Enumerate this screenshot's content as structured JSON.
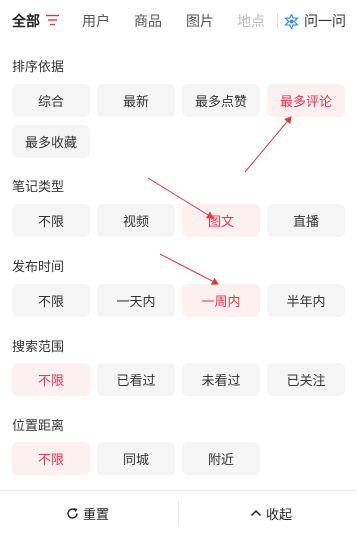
{
  "tabs": [
    {
      "label": "全部"
    },
    {
      "label": "用户"
    },
    {
      "label": "商品"
    },
    {
      "label": "图片"
    },
    {
      "label": "地点"
    }
  ],
  "ask": {
    "label": "问一问"
  },
  "sections": [
    {
      "title": "排序依据",
      "options": [
        "综合",
        "最新",
        "最多点赞",
        "最多评论",
        "最多收藏"
      ],
      "selected": "最多评论"
    },
    {
      "title": "笔记类型",
      "options": [
        "不限",
        "视频",
        "图文",
        "直播"
      ],
      "selected": "图文"
    },
    {
      "title": "发布时间",
      "options": [
        "不限",
        "一天内",
        "一周内",
        "半年内"
      ],
      "selected": "一周内"
    },
    {
      "title": "搜索范围",
      "options": [
        "不限",
        "已看过",
        "未看过",
        "已关注"
      ],
      "selected": "不限"
    },
    {
      "title": "位置距离",
      "options": [
        "不限",
        "同城",
        "附近"
      ],
      "selected": "不限"
    }
  ],
  "bottom": {
    "reset_label": "重置",
    "collapse_label": "收起"
  },
  "colors": {
    "accent": "#e8364f",
    "selected_bg": "#fdf0f1",
    "chip_bg": "#f5f5f5"
  }
}
